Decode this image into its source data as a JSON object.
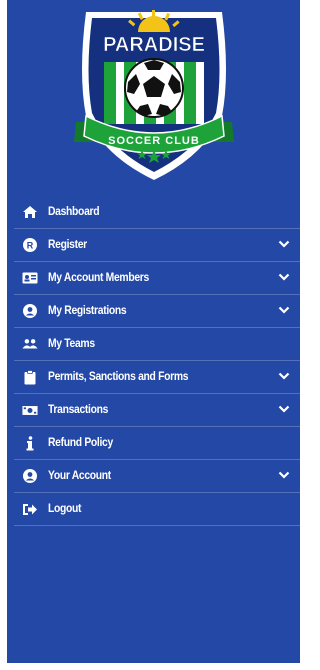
{
  "logo": {
    "top_text": "PARADISE",
    "bottom_text": "SOCCER CLUB",
    "colors": {
      "navy": "#15307f",
      "green": "#1da33a",
      "sun": "#f3c317",
      "white": "#ffffff"
    }
  },
  "colors": {
    "sidebar_bg": "#2448a5",
    "page_bg": "#ffffff",
    "text": "#ffffff",
    "divider": "rgba(255,255,255,0.22)"
  },
  "menu": {
    "items": [
      {
        "label": "Dashboard",
        "icon": "home-icon",
        "has_submenu": false
      },
      {
        "label": "Register",
        "icon": "register-icon",
        "has_submenu": true
      },
      {
        "label": "My Account Members",
        "icon": "id-card-icon",
        "has_submenu": true
      },
      {
        "label": "My Registrations",
        "icon": "user-circle-icon",
        "has_submenu": true
      },
      {
        "label": "My Teams",
        "icon": "users-icon",
        "has_submenu": false
      },
      {
        "label": "Permits, Sanctions and Forms",
        "icon": "clipboard-icon",
        "has_submenu": true
      },
      {
        "label": "Transactions",
        "icon": "money-icon",
        "has_submenu": true
      },
      {
        "label": "Refund Policy",
        "icon": "info-icon",
        "has_submenu": false
      },
      {
        "label": "Your Account",
        "icon": "user-circle-icon",
        "has_submenu": true
      },
      {
        "label": "Logout",
        "icon": "logout-icon",
        "has_submenu": false
      }
    ]
  }
}
